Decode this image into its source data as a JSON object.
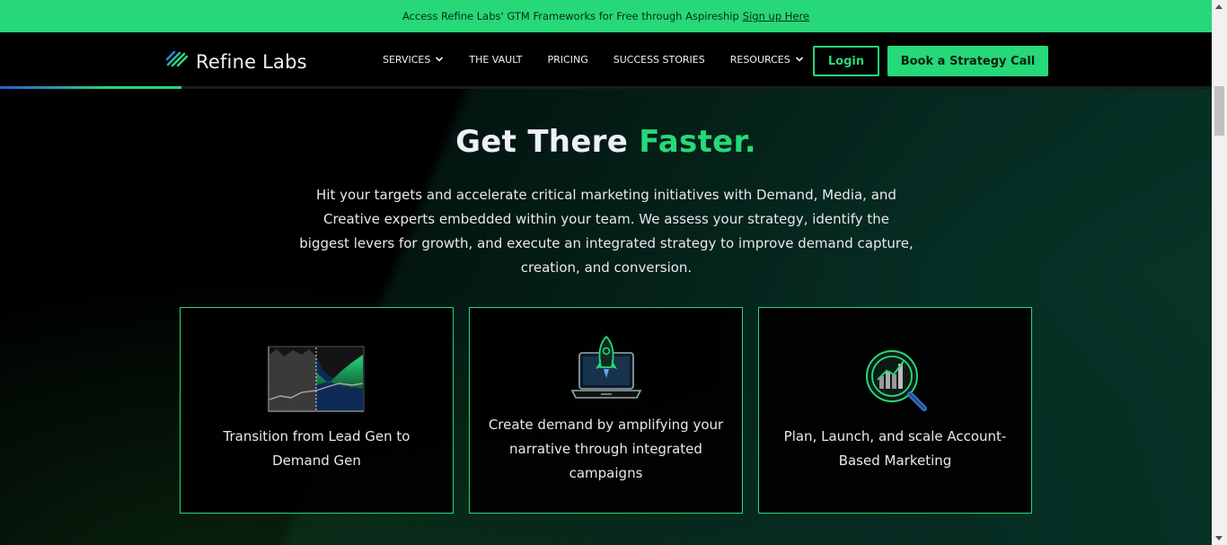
{
  "announcement": {
    "text": "Access Refine Labs' GTM Frameworks for Free through Aspireship",
    "link_label": "Sign up Here"
  },
  "brand": {
    "name": "Refine Labs",
    "accent": "#26d878",
    "logo_icon": "refine-labs-stripes-icon"
  },
  "nav": {
    "items": [
      {
        "label": "SERVICES",
        "dropdown": true
      },
      {
        "label": "THE VAULT",
        "dropdown": false
      },
      {
        "label": "PRICING",
        "dropdown": false
      },
      {
        "label": "SUCCESS STORIES",
        "dropdown": false
      },
      {
        "label": "RESOURCES",
        "dropdown": true
      }
    ],
    "login_label": "Login",
    "cta_label": "Book a Strategy Call"
  },
  "hero": {
    "headline_main": "Get There",
    "headline_accent": "Faster.",
    "intro": "Hit your targets and accelerate critical marketing initiatives with Demand, Media, and Creative experts embedded within your team.  We assess your strategy, identify the biggest levers for growth, and execute an integrated strategy to improve demand capture, creation, and conversion."
  },
  "cards": [
    {
      "text": "Transition from Lead Gen to Demand Gen",
      "icon": "chart-transition-icon"
    },
    {
      "text": "Create demand by amplifying your narrative through integrated campaigns",
      "icon": "rocket-laptop-icon"
    },
    {
      "text": "Plan, Launch, and scale Account-Based Marketing",
      "icon": "magnifier-chart-icon"
    }
  ]
}
